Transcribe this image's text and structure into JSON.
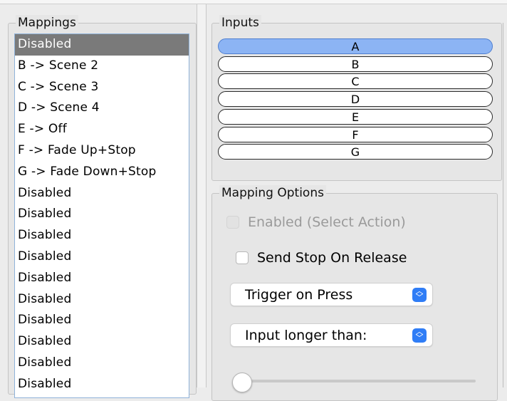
{
  "mappings": {
    "legend": "Mappings",
    "items": [
      "Disabled",
      "B -> Scene 2",
      "C -> Scene 3",
      "D -> Scene 4",
      "E -> Off",
      "F -> Fade Up+Stop",
      "G -> Fade Down+Stop",
      "Disabled",
      "Disabled",
      "Disabled",
      "Disabled",
      "Disabled",
      "Disabled",
      "Disabled",
      "Disabled",
      "Disabled",
      "Disabled"
    ],
    "selected_index": 0
  },
  "inputs": {
    "legend": "Inputs",
    "items": [
      "A",
      "B",
      "C",
      "D",
      "E",
      "F",
      "G"
    ],
    "selected_index": 0
  },
  "options": {
    "legend": "Mapping Options",
    "enabled_label": "Enabled (Select Action)",
    "send_stop_label": "Send Stop On Release",
    "trigger_select": "Trigger on Press",
    "input_select": "Input longer than:",
    "slider_value": 0
  },
  "colors": {
    "selected_input": "#8cb4f4",
    "selected_list": "#7a7a7a",
    "select_arrow": "#2f7df6"
  }
}
